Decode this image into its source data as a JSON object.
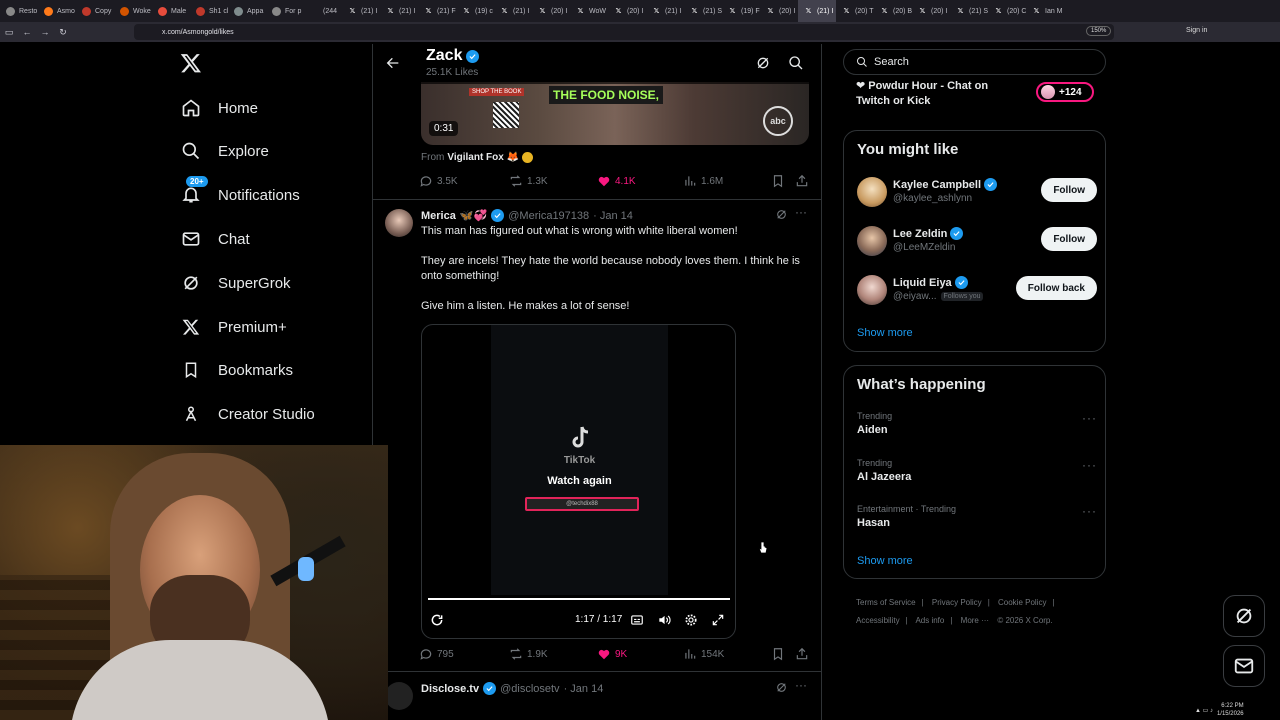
{
  "browser": {
    "tabs": [
      "Resto",
      "Asmo",
      "Copy",
      "Woke",
      "Male",
      "Sh1 cl",
      "Appa",
      "For p",
      "(244",
      "(21) I",
      "(21) I",
      "(21) F",
      "(19) c",
      "(21) I",
      "(20) I",
      "WoW",
      "(20) I",
      "(21) I",
      "(21) S",
      "(19) F",
      "(20) I",
      "(21) I",
      "(20) T",
      "(20) B",
      "(20) I",
      "(21) S",
      "(20) C",
      "Ian M"
    ],
    "active_tab_index": 21,
    "url": "x.com/Asmongold/likes",
    "zoom": "150%",
    "signin": "Sign in"
  },
  "nav": {
    "items": [
      {
        "label": "Home",
        "icon": "home-icon"
      },
      {
        "label": "Explore",
        "icon": "search-icon"
      },
      {
        "label": "Notifications",
        "icon": "bell-icon",
        "badge": "20+"
      },
      {
        "label": "Chat",
        "icon": "mail-icon"
      },
      {
        "label": "SuperGrok",
        "icon": "grok-icon"
      },
      {
        "label": "Premium+",
        "icon": "x-icon"
      },
      {
        "label": "Bookmarks",
        "icon": "bookmark-icon"
      },
      {
        "label": "Creator Studio",
        "icon": "creator-icon"
      }
    ]
  },
  "header": {
    "title": "Zack",
    "subtitle": "25.1K Likes"
  },
  "tweet1": {
    "video_caption": "THE FOOD NOISE,",
    "book_label": "SHOP THE BOOK",
    "duration": "0:31",
    "network_logo": "abc",
    "from_prefix": "From",
    "from_name": "Vigilant Fox",
    "from_emoji": "🦊",
    "replies": "3.5K",
    "reposts": "1.3K",
    "likes": "4.1K",
    "views": "1.6M"
  },
  "tweet2": {
    "name": "Merica",
    "emojis": "🦋💞",
    "handle": "@Merica197138",
    "date": "· Jan 14",
    "text1": "This man has figured out what is wrong with white liberal women!",
    "text2": "They are incels! They hate the world because nobody loves them. I think he is onto something!",
    "text3": "Give him a listen. He makes a lot of sense!",
    "tiktok_label": "TikTok",
    "watch_again": "Watch again",
    "tiktok_handle": "@techdix88",
    "time": "1:17 / 1:17",
    "replies": "795",
    "reposts": "1.9K",
    "likes": "9K",
    "views": "154K"
  },
  "tweet3": {
    "name": "Disclose.tv",
    "handle": "@disclosetv",
    "date": "· Jan 14"
  },
  "right": {
    "search_placeholder": "Search",
    "live_title": "Powdur Hour - Chat on Twitch or Kick",
    "live_count": "+124",
    "suggest_title": "You might like",
    "suggestions": [
      {
        "name": "Kaylee Campbell",
        "handle": "@kaylee_ashlynn",
        "button": "Follow",
        "follows_you": ""
      },
      {
        "name": "Lee Zeldin",
        "handle": "@LeeMZeldin",
        "button": "Follow",
        "follows_you": ""
      },
      {
        "name": "Liquid Eiya",
        "handle": "@eiyaw...",
        "button": "Follow back",
        "follows_you": "Follows you"
      }
    ],
    "show_more": "Show more",
    "happening_title": "What’s happening",
    "trends": [
      {
        "context": "Trending",
        "title": "Aiden"
      },
      {
        "context": "Trending",
        "title": "Al Jazeera"
      },
      {
        "context": "Entertainment · Trending",
        "title": "Hasan"
      }
    ],
    "footer": [
      "Terms of Service",
      "|",
      "Privacy Policy",
      "|",
      "Cookie Policy",
      "|",
      "Accessibility",
      "|",
      "Ads info",
      "|",
      "More ···",
      "© 2026 X Corp."
    ]
  },
  "taskbar": {
    "time": "6:22 PM",
    "date": "1/15/2026"
  },
  "colors": {
    "accent": "#1d9bf0",
    "like": "#f91880",
    "bg": "#000000",
    "border": "#2f3336"
  }
}
